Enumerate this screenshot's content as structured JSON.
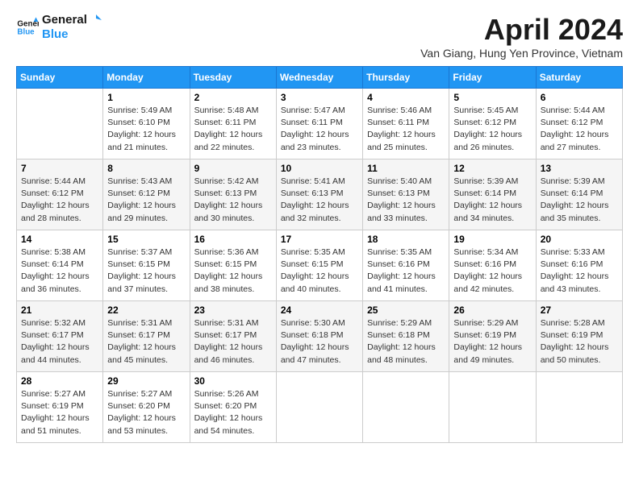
{
  "header": {
    "logo_line1": "General",
    "logo_line2": "Blue",
    "month_title": "April 2024",
    "subtitle": "Van Giang, Hung Yen Province, Vietnam"
  },
  "weekdays": [
    "Sunday",
    "Monday",
    "Tuesday",
    "Wednesday",
    "Thursday",
    "Friday",
    "Saturday"
  ],
  "weeks": [
    [
      {
        "day": "",
        "info": ""
      },
      {
        "day": "1",
        "info": "Sunrise: 5:49 AM\nSunset: 6:10 PM\nDaylight: 12 hours\nand 21 minutes."
      },
      {
        "day": "2",
        "info": "Sunrise: 5:48 AM\nSunset: 6:11 PM\nDaylight: 12 hours\nand 22 minutes."
      },
      {
        "day": "3",
        "info": "Sunrise: 5:47 AM\nSunset: 6:11 PM\nDaylight: 12 hours\nand 23 minutes."
      },
      {
        "day": "4",
        "info": "Sunrise: 5:46 AM\nSunset: 6:11 PM\nDaylight: 12 hours\nand 25 minutes."
      },
      {
        "day": "5",
        "info": "Sunrise: 5:45 AM\nSunset: 6:12 PM\nDaylight: 12 hours\nand 26 minutes."
      },
      {
        "day": "6",
        "info": "Sunrise: 5:44 AM\nSunset: 6:12 PM\nDaylight: 12 hours\nand 27 minutes."
      }
    ],
    [
      {
        "day": "7",
        "info": "Sunrise: 5:44 AM\nSunset: 6:12 PM\nDaylight: 12 hours\nand 28 minutes."
      },
      {
        "day": "8",
        "info": "Sunrise: 5:43 AM\nSunset: 6:12 PM\nDaylight: 12 hours\nand 29 minutes."
      },
      {
        "day": "9",
        "info": "Sunrise: 5:42 AM\nSunset: 6:13 PM\nDaylight: 12 hours\nand 30 minutes."
      },
      {
        "day": "10",
        "info": "Sunrise: 5:41 AM\nSunset: 6:13 PM\nDaylight: 12 hours\nand 32 minutes."
      },
      {
        "day": "11",
        "info": "Sunrise: 5:40 AM\nSunset: 6:13 PM\nDaylight: 12 hours\nand 33 minutes."
      },
      {
        "day": "12",
        "info": "Sunrise: 5:39 AM\nSunset: 6:14 PM\nDaylight: 12 hours\nand 34 minutes."
      },
      {
        "day": "13",
        "info": "Sunrise: 5:39 AM\nSunset: 6:14 PM\nDaylight: 12 hours\nand 35 minutes."
      }
    ],
    [
      {
        "day": "14",
        "info": "Sunrise: 5:38 AM\nSunset: 6:14 PM\nDaylight: 12 hours\nand 36 minutes."
      },
      {
        "day": "15",
        "info": "Sunrise: 5:37 AM\nSunset: 6:15 PM\nDaylight: 12 hours\nand 37 minutes."
      },
      {
        "day": "16",
        "info": "Sunrise: 5:36 AM\nSunset: 6:15 PM\nDaylight: 12 hours\nand 38 minutes."
      },
      {
        "day": "17",
        "info": "Sunrise: 5:35 AM\nSunset: 6:15 PM\nDaylight: 12 hours\nand 40 minutes."
      },
      {
        "day": "18",
        "info": "Sunrise: 5:35 AM\nSunset: 6:16 PM\nDaylight: 12 hours\nand 41 minutes."
      },
      {
        "day": "19",
        "info": "Sunrise: 5:34 AM\nSunset: 6:16 PM\nDaylight: 12 hours\nand 42 minutes."
      },
      {
        "day": "20",
        "info": "Sunrise: 5:33 AM\nSunset: 6:16 PM\nDaylight: 12 hours\nand 43 minutes."
      }
    ],
    [
      {
        "day": "21",
        "info": "Sunrise: 5:32 AM\nSunset: 6:17 PM\nDaylight: 12 hours\nand 44 minutes."
      },
      {
        "day": "22",
        "info": "Sunrise: 5:31 AM\nSunset: 6:17 PM\nDaylight: 12 hours\nand 45 minutes."
      },
      {
        "day": "23",
        "info": "Sunrise: 5:31 AM\nSunset: 6:17 PM\nDaylight: 12 hours\nand 46 minutes."
      },
      {
        "day": "24",
        "info": "Sunrise: 5:30 AM\nSunset: 6:18 PM\nDaylight: 12 hours\nand 47 minutes."
      },
      {
        "day": "25",
        "info": "Sunrise: 5:29 AM\nSunset: 6:18 PM\nDaylight: 12 hours\nand 48 minutes."
      },
      {
        "day": "26",
        "info": "Sunrise: 5:29 AM\nSunset: 6:19 PM\nDaylight: 12 hours\nand 49 minutes."
      },
      {
        "day": "27",
        "info": "Sunrise: 5:28 AM\nSunset: 6:19 PM\nDaylight: 12 hours\nand 50 minutes."
      }
    ],
    [
      {
        "day": "28",
        "info": "Sunrise: 5:27 AM\nSunset: 6:19 PM\nDaylight: 12 hours\nand 51 minutes."
      },
      {
        "day": "29",
        "info": "Sunrise: 5:27 AM\nSunset: 6:20 PM\nDaylight: 12 hours\nand 53 minutes."
      },
      {
        "day": "30",
        "info": "Sunrise: 5:26 AM\nSunset: 6:20 PM\nDaylight: 12 hours\nand 54 minutes."
      },
      {
        "day": "",
        "info": ""
      },
      {
        "day": "",
        "info": ""
      },
      {
        "day": "",
        "info": ""
      },
      {
        "day": "",
        "info": ""
      }
    ]
  ]
}
